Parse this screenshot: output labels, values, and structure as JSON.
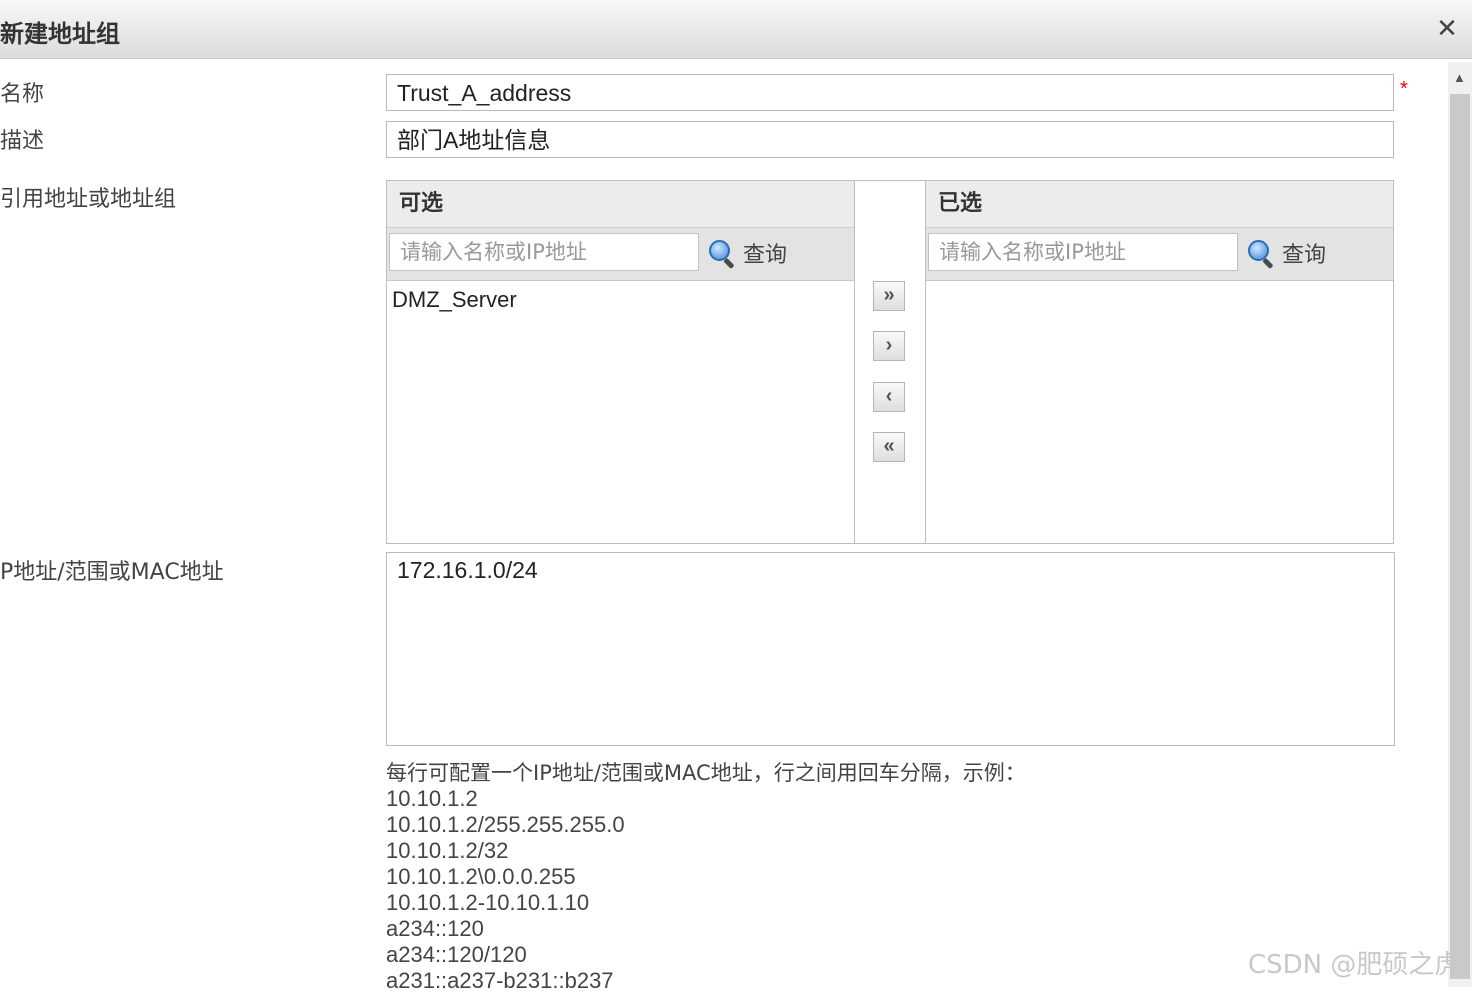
{
  "dialog": {
    "title": "新建地址组",
    "close_glyph": "✕"
  },
  "labels": {
    "name": "名称",
    "description": "描述",
    "reference": "引用地址或地址组",
    "ip_range": "P地址/范围或MAC地址"
  },
  "fields": {
    "name_value": "Trust_A_address",
    "required_mark": "*",
    "description_value": "部门A地址信息"
  },
  "available": {
    "header": "可选",
    "search_placeholder": "请输入名称或IP地址",
    "search_button": "查询",
    "items": [
      "DMZ_Server"
    ]
  },
  "selected": {
    "header": "已选",
    "search_placeholder": "请输入名称或IP地址",
    "search_button": "查询",
    "items": []
  },
  "move_buttons": {
    "add_all": "»",
    "add": "›",
    "remove": "‹",
    "remove_all": "«"
  },
  "ip_textarea": {
    "value": "172.16.1.0/24"
  },
  "hint": {
    "title": "每行可配置一个IP地址/范围或MAC地址，行之间用回车分隔，示例：",
    "examples": [
      "10.10.1.2",
      "10.10.1.2/255.255.255.0",
      "10.10.1.2/32",
      "10.10.1.2\\0.0.0.255",
      "10.10.1.2-10.10.1.10",
      "a234::120",
      "a234::120/120",
      "a231::a237-b231::b237"
    ]
  },
  "watermark": "CSDN @肥硕之虎"
}
